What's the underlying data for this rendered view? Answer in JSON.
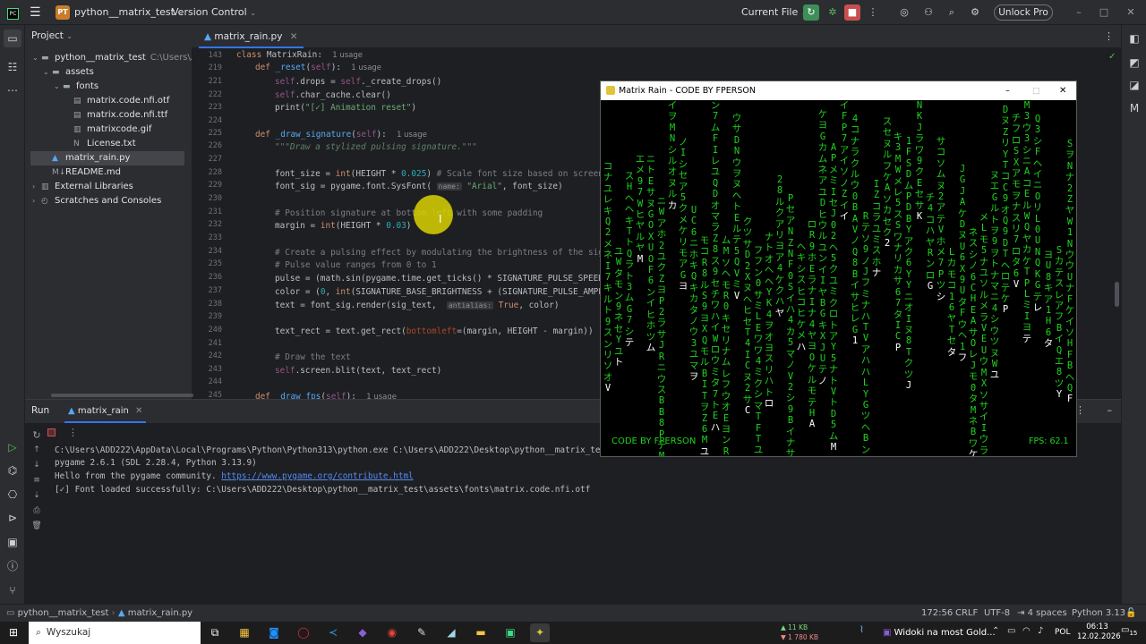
{
  "titlebar": {
    "project_badge": "PT",
    "project_name": "python__matrix_test",
    "vcs": "Version Control",
    "run_config": "Current File",
    "unlock": "Unlock Pro"
  },
  "project_panel": {
    "title": "Project",
    "tree": [
      {
        "label": "python__matrix_test",
        "suffix": "C:\\Users\\ADD2",
        "indent": 0,
        "kind": "folder",
        "open": true
      },
      {
        "label": "assets",
        "indent": 1,
        "kind": "folder",
        "open": true
      },
      {
        "label": "fonts",
        "indent": 2,
        "kind": "folder",
        "open": true
      },
      {
        "label": "matrix.code.nfi.otf",
        "indent": 3,
        "kind": "font"
      },
      {
        "label": "matrix.code.nfi.ttf",
        "indent": 3,
        "kind": "font"
      },
      {
        "label": "matrixcode.gif",
        "indent": 3,
        "kind": "image"
      },
      {
        "label": "License.txt",
        "indent": 3,
        "kind": "text"
      },
      {
        "label": "matrix_rain.py",
        "indent": 1,
        "kind": "python",
        "selected": true
      },
      {
        "label": "README.md",
        "indent": 1,
        "kind": "markdown"
      },
      {
        "label": "External Libraries",
        "indent": 0,
        "kind": "lib"
      },
      {
        "label": "Scratches and Consoles",
        "indent": 0,
        "kind": "scratch"
      }
    ]
  },
  "editor": {
    "tab": "matrix_rain.py",
    "line_numbers": [
      "143",
      "219",
      "221",
      "222",
      "223",
      "224",
      "225",
      "226",
      "227",
      "228",
      "229",
      "230",
      "231",
      "232",
      "233",
      "234",
      "235",
      "236",
      "237",
      "238",
      "239",
      "240",
      "241",
      "242",
      "243",
      "244",
      "245"
    ],
    "usage": "1 usage",
    "hint_name": "name:",
    "hint_antialias": "antialias:"
  },
  "run_panel": {
    "tab_run": "Run",
    "tab_file": "matrix_rain",
    "lines": [
      "C:\\Users\\ADD222\\AppData\\Local\\Programs\\Python\\Python313\\python.exe C:\\Users\\ADD222\\Desktop\\python__matrix_test\\mat",
      "pygame 2.6.1 (SDL 2.28.4, Python 3.13.9)",
      "Hello from the pygame community. ",
      "[✓] Font loaded successfully: C:\\Users\\ADD222\\Desktop\\python__matrix_test\\assets\\fonts\\matrix.code.nfi.otf"
    ],
    "link": "https://www.pygame.org/contribute.html"
  },
  "matrix_window": {
    "title": "Matrix Rain - CODE BY FPERSON",
    "signature": "CODE BY FPERSON",
    "fps": "FPS: 62.1"
  },
  "statusbar": {
    "breadcrumb_project": "python__matrix_test",
    "breadcrumb_file": "matrix_rain.py",
    "position": "172:56",
    "line_sep": "CRLF",
    "encoding": "UTF-8",
    "indent": "4 spaces",
    "interpreter": "Python 3.13"
  },
  "taskbar": {
    "search": "Wyszukaj",
    "net_up": "▲ 11 KB",
    "net_down": "▼ 1 780 KB",
    "news": "Widoki na most Gold...",
    "lang": "POL",
    "time": "06:13",
    "date": "12.02.2026",
    "notif": "15"
  },
  "colors": {
    "accent": "#3574f0",
    "matrix_green": "#1fd41f",
    "editor_bg": "#1e1f22",
    "panel_bg": "#2b2d30"
  }
}
